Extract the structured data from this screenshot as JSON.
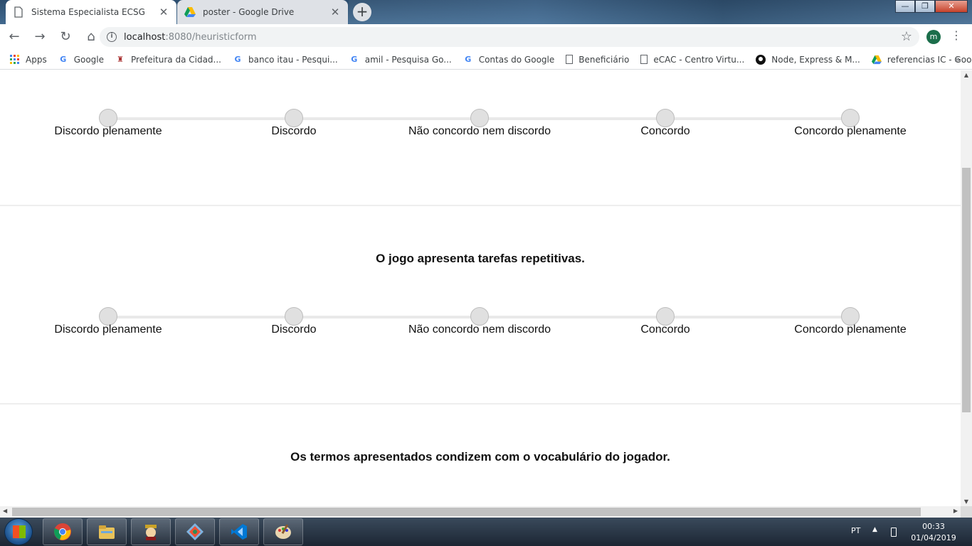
{
  "browser": {
    "tabs": [
      {
        "title": "Sistema Especialista ECSG",
        "active": true
      },
      {
        "title": "poster - Google Drive",
        "active": false
      }
    ],
    "new_tab_label": "+",
    "close_glyph": "✕",
    "window_controls": {
      "minimize": "—",
      "maximize": "❐",
      "close": "✕"
    },
    "url_host": "localhost",
    "url_path": ":8080/heuristicform",
    "profile_initial": "m",
    "bookmarks": [
      {
        "label": "Apps",
        "icon": "apps-grid-icon"
      },
      {
        "label": "Google",
        "icon": "google-icon"
      },
      {
        "label": "Prefeitura da Cidad...",
        "icon": "prefeitura-icon"
      },
      {
        "label": "banco itau - Pesqui...",
        "icon": "google-icon"
      },
      {
        "label": "amil - Pesquisa Go...",
        "icon": "google-icon"
      },
      {
        "label": "Contas do Google",
        "icon": "google-icon"
      },
      {
        "label": "Beneficiário",
        "icon": "document-icon"
      },
      {
        "label": "eCAC - Centro Virtu...",
        "icon": "document-icon"
      },
      {
        "label": "Node, Express & M...",
        "icon": "github-icon"
      },
      {
        "label": "referencias IC - Goo...",
        "icon": "google-drive-icon"
      }
    ],
    "bookmarks_more": "»"
  },
  "form": {
    "scale_options": [
      "Discordo plenamente",
      "Discordo",
      "Não concordo nem discordo",
      "Concordo",
      "Concordo plenamente"
    ],
    "questions": [
      {
        "text": ""
      },
      {
        "text": "O jogo apresenta tarefas repetitivas."
      },
      {
        "text": "Os termos apresentados condizem com o vocabulário do jogador."
      }
    ]
  },
  "taskbar": {
    "apps": [
      "chrome-icon",
      "file-explorer-icon",
      "game-icon",
      "git-icon",
      "vscode-icon",
      "paint-icon"
    ],
    "language": "PT",
    "time": "00:33",
    "date": "01/04/2019"
  },
  "colors": {
    "accent": "#1b6e4b",
    "radio_fill": "#e0e0e0",
    "track": "#e9e9e9"
  }
}
